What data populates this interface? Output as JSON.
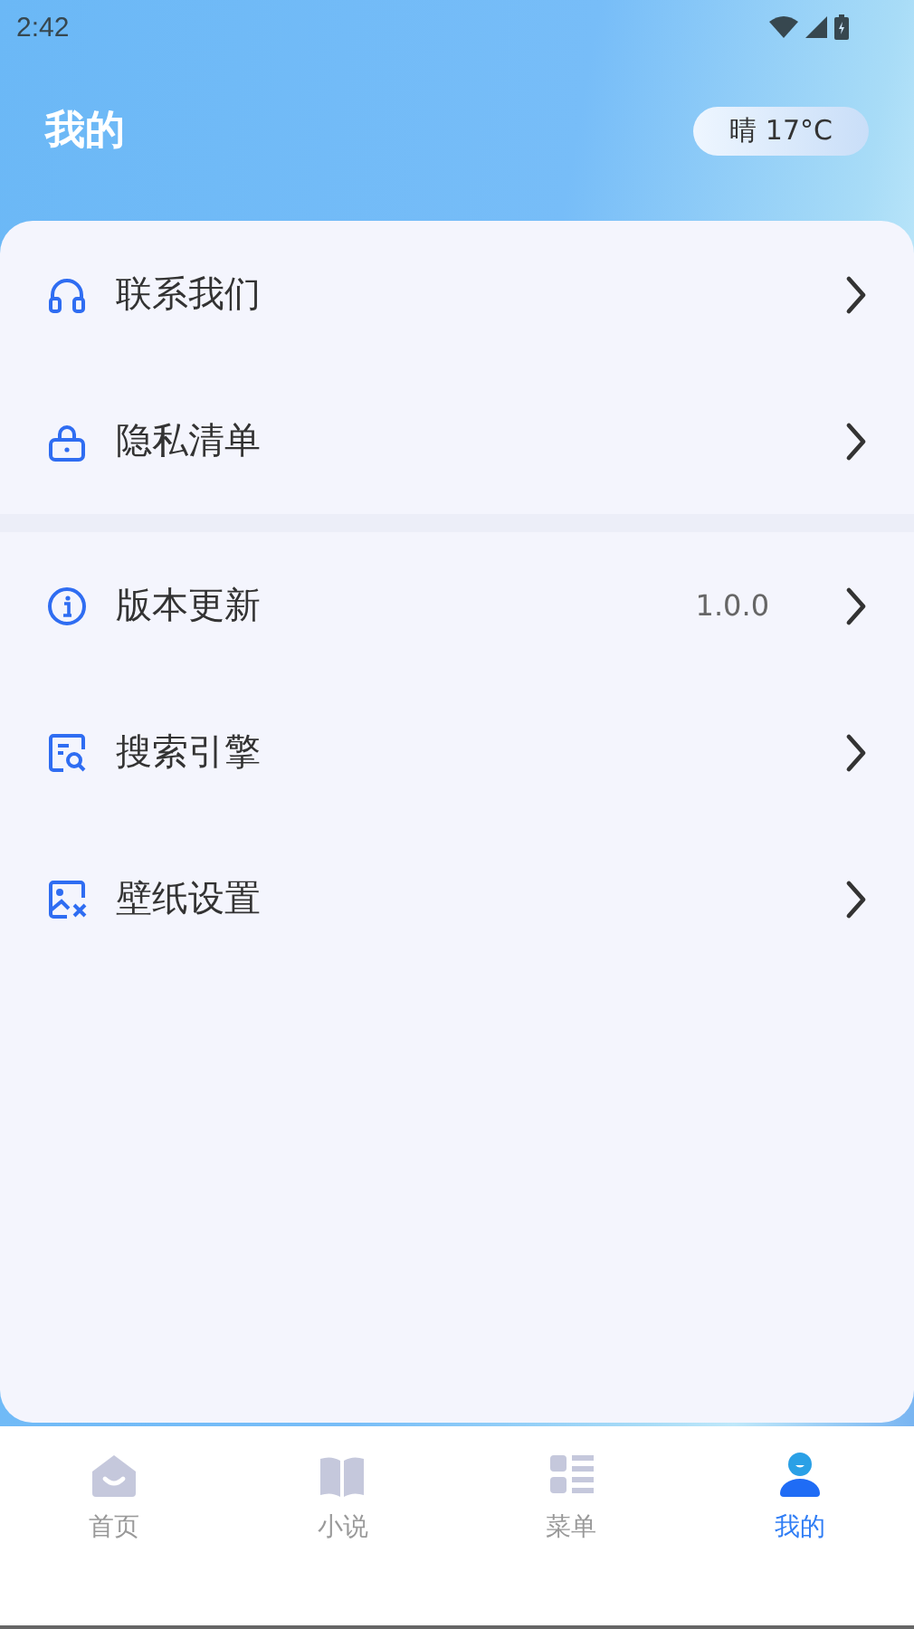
{
  "status_bar": {
    "time": "2:42"
  },
  "header": {
    "title": "我的",
    "weather": "晴 17°C"
  },
  "groups": [
    [
      {
        "label": "联系我们"
      },
      {
        "label": "隐私清单"
      }
    ],
    [
      {
        "label": "版本更新",
        "value": "1.0.0"
      },
      {
        "label": "搜索引擎"
      },
      {
        "label": "壁纸设置"
      }
    ]
  ],
  "nav": [
    {
      "label": "首页",
      "selected": false
    },
    {
      "label": "小说",
      "selected": false
    },
    {
      "label": "菜单",
      "selected": false
    },
    {
      "label": "我的",
      "selected": true
    }
  ]
}
